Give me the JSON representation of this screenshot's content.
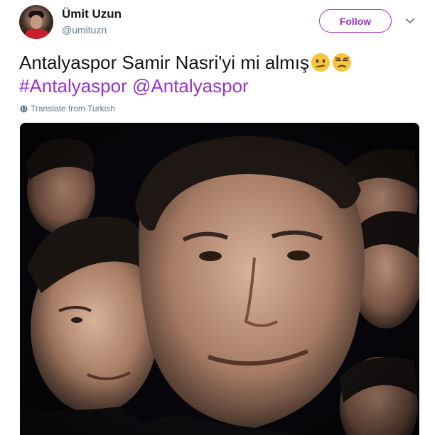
{
  "user": {
    "display_name": "Ümit Uzun",
    "screen_name": "@umituzn"
  },
  "follow": {
    "label": "Follow"
  },
  "tweet": {
    "text": "Antalyaspor Samir Nasri'yi mi almış",
    "emojis": [
      "confused-face-emoji",
      "unamused-face-emoji"
    ],
    "hashtag": "#Antalyaspor",
    "mention": "@Antalyaspor",
    "translate_label": "Translate from Turkish"
  },
  "theme": {
    "accent": "#9932cc",
    "text_primary": "#14171a",
    "text_secondary": "#657786",
    "emoji_yellow": "#f5c53a"
  },
  "icons": {
    "caret": "chevron-down-icon",
    "globe": "globe-icon"
  }
}
